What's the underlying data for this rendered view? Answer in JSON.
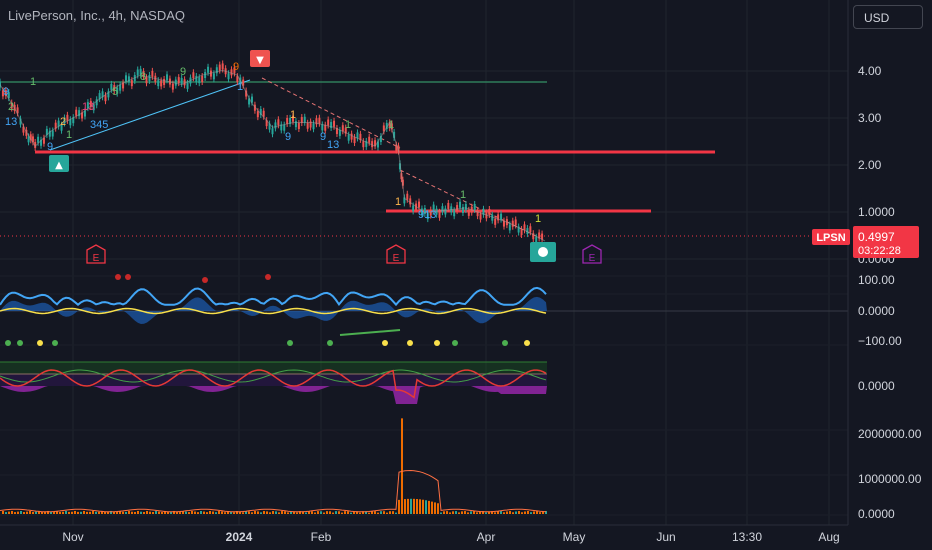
{
  "header": {
    "title": "LivePerson, Inc., 4h, NASDAQ",
    "currency_button": "USD"
  },
  "price_marker": {
    "symbol": "LPSN",
    "price": "0.4997",
    "countdown": "03:22:28"
  },
  "colors": {
    "background": "#141722",
    "grid": "#20242e",
    "up": "#26a69a",
    "down": "#ef5350",
    "support_line": "#f23645",
    "channel_line": "#2e7d5b",
    "earnings": "#f23645",
    "earnings_future": "#9c27b0",
    "oscillator_line": "#42a5f5"
  },
  "chart_data": [
    {
      "type": "line",
      "panel": "price",
      "x": [
        "Nov",
        "2024",
        "Feb",
        "Apr",
        "May",
        "Jun",
        "13:30",
        "Aug"
      ],
      "y_ticks": [
        "4.00",
        "3.00",
        "2.00",
        "1.0000",
        "0.0000"
      ],
      "ylim": [
        0,
        4.3
      ],
      "series": [
        {
          "name": "LPSN",
          "points": [
            [
              "2023-10-17",
              3.7
            ],
            [
              "2023-10-22",
              3.2
            ],
            [
              "2023-10-26",
              2.7
            ],
            [
              "2023-10-29",
              2.4
            ],
            [
              "2023-11-03",
              2.7
            ],
            [
              "2023-11-08",
              2.9
            ],
            [
              "2023-11-14",
              3.1
            ],
            [
              "2023-11-20",
              3.4
            ],
            [
              "2023-11-27",
              3.7
            ],
            [
              "2023-12-04",
              3.9
            ],
            [
              "2023-12-11",
              3.8
            ],
            [
              "2023-12-18",
              3.7
            ],
            [
              "2023-12-25",
              3.9
            ],
            [
              "2024-01-01",
              4.0
            ],
            [
              "2024-01-06",
              3.9
            ],
            [
              "2024-01-11",
              3.3
            ],
            [
              "2024-01-18",
              2.8
            ],
            [
              "2024-01-25",
              2.9
            ],
            [
              "2024-02-01",
              2.9
            ],
            [
              "2024-02-08",
              2.8
            ],
            [
              "2024-02-15",
              2.6
            ],
            [
              "2024-02-22",
              2.4
            ],
            [
              "2024-02-27",
              2.9
            ],
            [
              "2024-03-01",
              2.3
            ],
            [
              "2024-03-03",
              1.3
            ],
            [
              "2024-03-10",
              1.0
            ],
            [
              "2024-03-17",
              1.05
            ],
            [
              "2024-03-24",
              1.1
            ],
            [
              "2024-03-31",
              0.95
            ],
            [
              "2024-04-07",
              0.8
            ],
            [
              "2024-04-14",
              0.6
            ],
            [
              "2024-04-20",
              0.4
            ]
          ]
        }
      ],
      "horizontal_levels": [
        {
          "name": "support-upper",
          "value": 2.3
        },
        {
          "name": "support-lower",
          "value": 1.05
        },
        {
          "name": "channel-top",
          "value": 3.8
        }
      ],
      "labels": {
        "buy_signal": "▲",
        "sell_signal": "▼",
        "earnings_marker": "E"
      }
    },
    {
      "type": "line",
      "panel": "oscillator",
      "y_ticks": [
        "100.00",
        "0.0000",
        "−100.00"
      ],
      "ylim": [
        -110,
        110
      ]
    },
    {
      "type": "area",
      "panel": "momentum",
      "y_ticks": [
        "0.0000"
      ]
    },
    {
      "type": "bar",
      "panel": "volume",
      "y_ticks": [
        "2000000.00",
        "1000000.00",
        "0.0000"
      ],
      "ylim": [
        0,
        2300000
      ]
    }
  ]
}
